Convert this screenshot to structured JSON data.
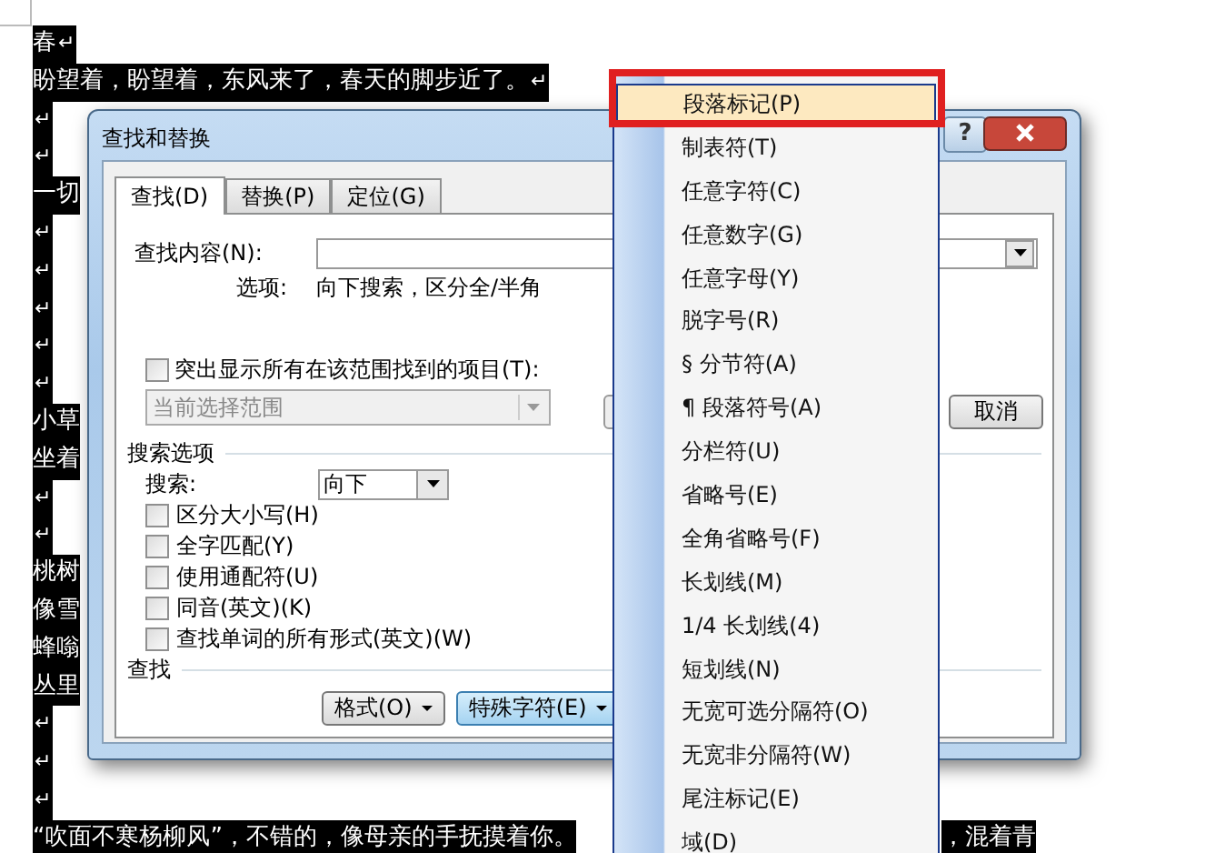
{
  "document": {
    "lines": [
      {
        "text": "春",
        "mark": "↵",
        "highlighted": true
      },
      {
        "text": "盼望着，盼望着，东风来了，春天的脚步近了。",
        "mark": "↵",
        "highlighted": true
      },
      {
        "mark": "↵",
        "highlighted": true
      },
      {
        "mark": "↵",
        "highlighted": true
      },
      {
        "text": "一切",
        "highlighted": true
      },
      {
        "mark": "↵",
        "highlighted": true
      },
      {
        "mark": "↵",
        "highlighted": true
      },
      {
        "mark": "↵",
        "highlighted": true
      },
      {
        "mark": "↵",
        "highlighted": true
      },
      {
        "mark": "↵",
        "highlighted": true
      },
      {
        "text": "小草",
        "highlighted": true
      },
      {
        "text": "坐着",
        "highlighted": true
      },
      {
        "mark": "↵",
        "highlighted": true
      },
      {
        "mark": "↵",
        "highlighted": true
      },
      {
        "text": "桃树",
        "highlighted": true
      },
      {
        "text": "像雪",
        "highlighted": true
      },
      {
        "text": "蜂嗡",
        "highlighted": true
      },
      {
        "text": "丛里",
        "highlighted": true
      },
      {
        "mark": "↵",
        "highlighted": true
      },
      {
        "mark": "↵",
        "highlighted": true
      },
      {
        "mark": "↵",
        "highlighted": true
      },
      {
        "text": "“吹面不寒杨柳风”，不错的，像母亲的手抚摸着你。",
        "highlighted": true
      }
    ],
    "trailing_text": {
      "text": "，混着青",
      "highlighted": true
    }
  },
  "dialog": {
    "title": "查找和替换",
    "help": "?",
    "tabs": [
      {
        "label": "查找(D)",
        "selected": true
      },
      {
        "label": "替换(P)",
        "selected": false
      },
      {
        "label": "定位(G)",
        "selected": false
      }
    ],
    "find_label": "查找内容(N):",
    "options_label": "选项:",
    "options_value": "向下搜索，区分全/半角",
    "highlight_option": {
      "label": "突出显示所有在该范围找到的项目(T):",
      "checked": false
    },
    "scope": {
      "value": "当前选择范围",
      "disabled": true
    },
    "cancel_button": "取消",
    "search_options_heading": "搜索选项",
    "search_label": "搜索:",
    "search_direction": "向下",
    "checkboxes": [
      {
        "label": "区分大小写(H)",
        "checked": false
      },
      {
        "label": "全字匹配(Y)",
        "checked": false
      },
      {
        "label": "使用通配符(U)",
        "checked": false
      },
      {
        "label": "同音(英文)(K)",
        "checked": false
      },
      {
        "label": "查找单词的所有形式(英文)(W)",
        "checked": false
      }
    ],
    "find_heading": "查找",
    "buttons": [
      {
        "label": "格式(O)",
        "active": false
      },
      {
        "label": "特殊字符(E)",
        "active": true
      }
    ]
  },
  "menu": {
    "items": [
      {
        "label": "段落标记(P)",
        "selected": true
      },
      {
        "label": "制表符(T)",
        "selected": false
      },
      {
        "label": "任意字符(C)",
        "selected": false
      },
      {
        "label": "任意数字(G)",
        "selected": false
      },
      {
        "label": "任意字母(Y)",
        "selected": false
      },
      {
        "label": "脱字号(R)",
        "selected": false
      },
      {
        "label": "§ 分节符(A)",
        "selected": false
      },
      {
        "label": "¶ 段落符号(A)",
        "selected": false
      },
      {
        "label": "分栏符(U)",
        "selected": false
      },
      {
        "label": "省略号(E)",
        "selected": false
      },
      {
        "label": "全角省略号(F)",
        "selected": false
      },
      {
        "label": "长划线(M)",
        "selected": false
      },
      {
        "label": "1/4 长划线(4)",
        "selected": false
      },
      {
        "label": "短划线(N)",
        "selected": false
      },
      {
        "label": "无宽可选分隔符(O)",
        "selected": false
      },
      {
        "label": "无宽非分隔符(W)",
        "selected": false
      },
      {
        "label": "尾注标记(E)",
        "selected": false
      },
      {
        "label": "域(D)",
        "selected": false
      }
    ]
  }
}
